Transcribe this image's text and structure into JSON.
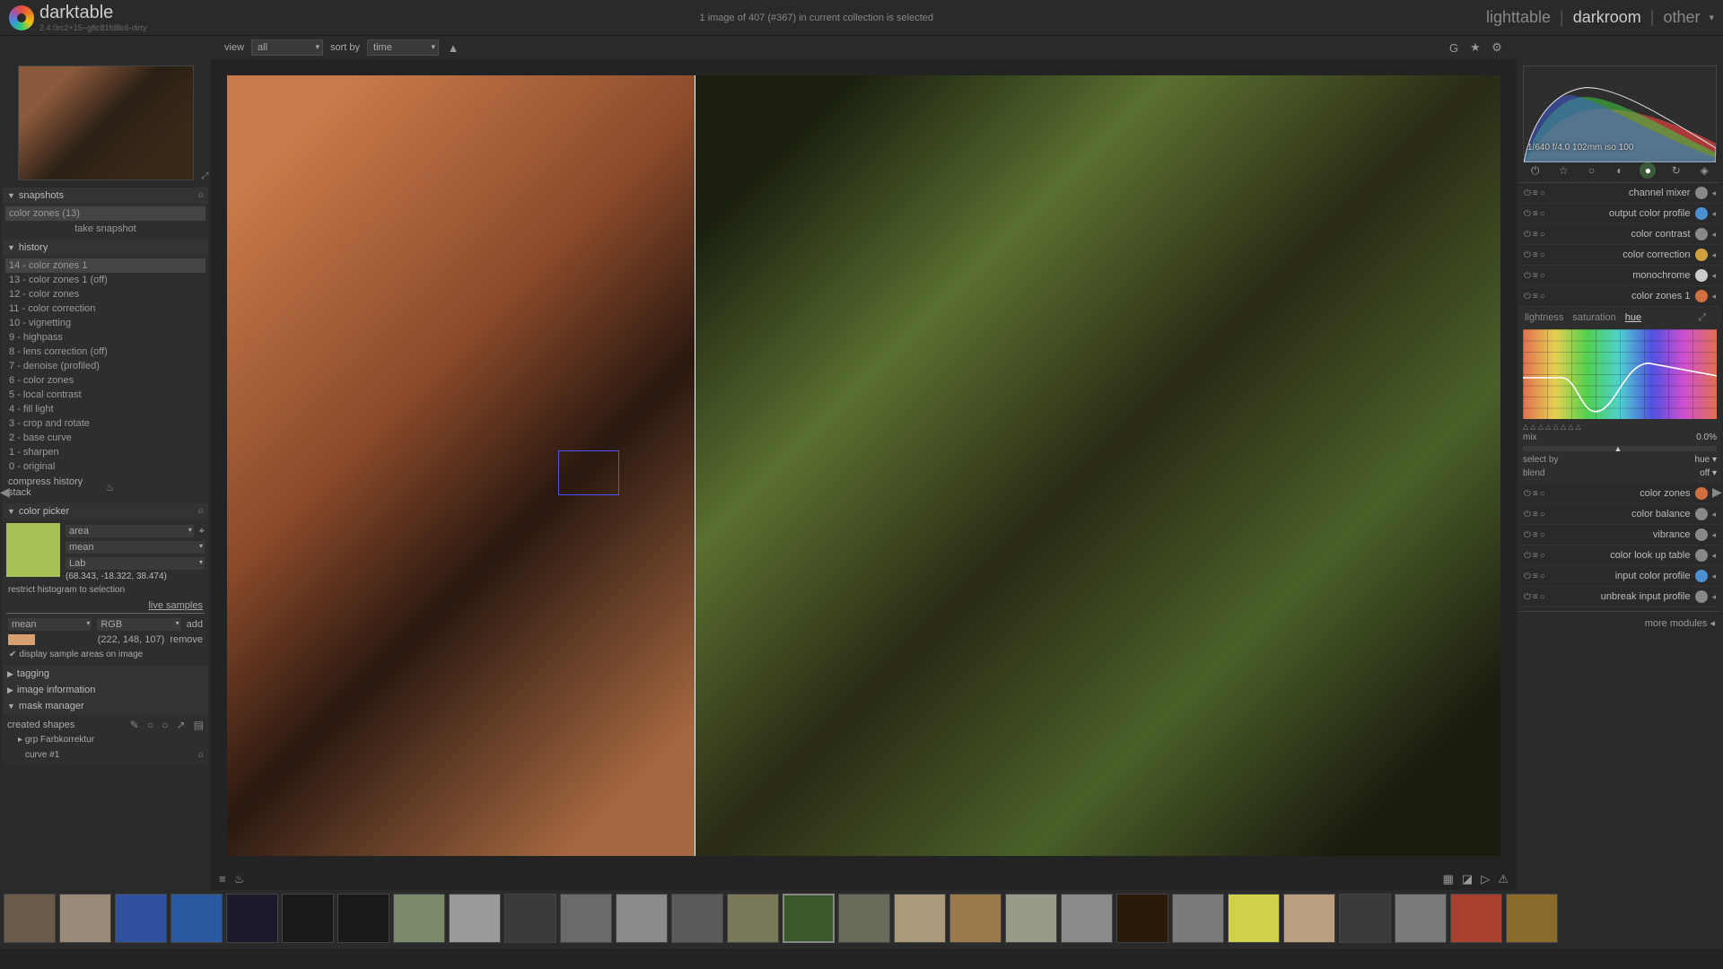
{
  "app": {
    "name": "darktable",
    "version": "2.4.0rc2+15~g8c81fd8c6-dirty"
  },
  "status": "1 image of 407 (#367) in current collection is selected",
  "nav": {
    "lighttable": "lighttable",
    "darkroom": "darkroom",
    "other": "other"
  },
  "toolbar": {
    "view_label": "view",
    "view_value": "all",
    "sort_label": "sort by",
    "sort_value": "time"
  },
  "snapshots": {
    "title": "snapshots",
    "item": "color zones (13)",
    "take": "take snapshot"
  },
  "history": {
    "title": "history",
    "items": [
      "14 - color zones 1",
      "13 - color zones 1 (off)",
      "12 - color zones",
      "11 - color correction",
      "10 - vignetting",
      "9 - highpass",
      "8 - lens correction (off)",
      "7 - denoise (profiled)",
      "6 - color zones",
      "5 - local contrast",
      "4 - fill light",
      "3 - crop and rotate",
      "2 - base curve",
      "1 - sharpen",
      "0 - original"
    ],
    "compress": "compress history stack"
  },
  "picker": {
    "title": "color picker",
    "mode": "area",
    "stat": "mean",
    "space": "Lab",
    "lab": "(68.343, -18.322, 38.474)",
    "restrict": "restrict histogram to selection",
    "live": "live samples",
    "mean": "mean",
    "rgb": "RGB",
    "add": "add",
    "sample_rgb": "(222, 148, 107)",
    "remove": "remove",
    "display": "display sample areas on image"
  },
  "tagging": {
    "title": "tagging"
  },
  "imageinfo": {
    "title": "image information"
  },
  "mask": {
    "title": "mask manager",
    "created": "created shapes",
    "grp": "grp Farbkorrektur",
    "curve": "curve #1"
  },
  "histo_info": "1/640 f/4.0 102mm iso 100",
  "modules": [
    {
      "name": "channel mixer",
      "color": "#888"
    },
    {
      "name": "output color profile",
      "color": "#4a90d0"
    },
    {
      "name": "color contrast",
      "color": "#888"
    },
    {
      "name": "color correction",
      "color": "#d0a040"
    },
    {
      "name": "monochrome",
      "color": "#ccc"
    },
    {
      "name": "color zones 1",
      "color": "#d07040",
      "expanded": true
    },
    {
      "name": "color zones",
      "color": "#d07040"
    },
    {
      "name": "color balance",
      "color": "#888"
    },
    {
      "name": "vibrance",
      "color": "#888"
    },
    {
      "name": "color look up table",
      "color": "#888"
    },
    {
      "name": "input color profile",
      "color": "#4a90d0"
    },
    {
      "name": "unbreak input profile",
      "color": "#888"
    }
  ],
  "colorzones": {
    "tabs": {
      "lightness": "lightness",
      "saturation": "saturation",
      "hue": "hue"
    },
    "mix_label": "mix",
    "mix_val": "0.0%",
    "select_label": "select by",
    "select_val": "hue",
    "blend_label": "blend",
    "blend_val": "off"
  },
  "more_modules": "more modules",
  "filmstrip_count": 28,
  "filmstrip_selected": 14
}
